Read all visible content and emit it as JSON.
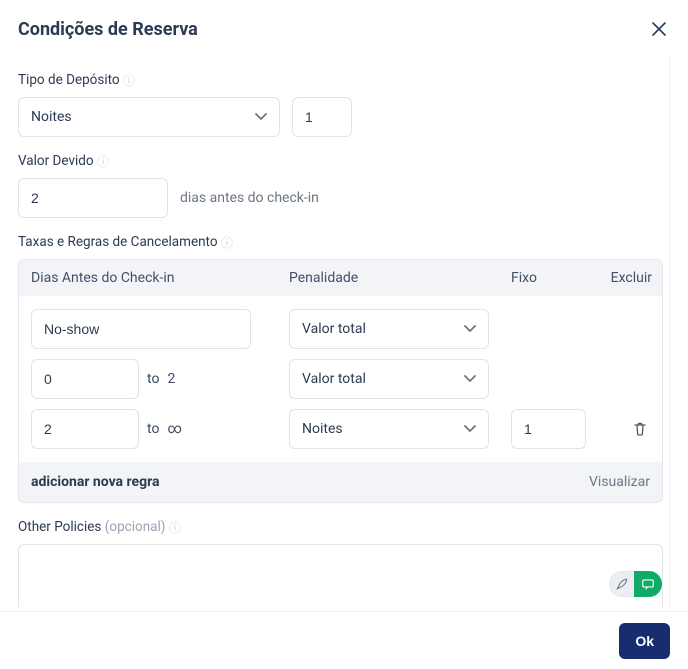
{
  "header": {
    "title": "Condições de Reserva"
  },
  "deposit": {
    "label": "Tipo de Depósito",
    "type_value": "Noites",
    "qty_value": "1"
  },
  "due": {
    "label": "Valor Devido",
    "days_value": "2",
    "hint": "dias antes do check-in"
  },
  "fees": {
    "label": "Taxas e Regras de Cancelamento",
    "headers": {
      "a": "Dias Antes do Check-in",
      "b": "Penalidade",
      "c": "Fixo",
      "d": "Excluir"
    },
    "to_word": "to",
    "rows": [
      {
        "from": "No-show",
        "to": "",
        "penalty": "Valor total",
        "fixed": "",
        "deletable": false
      },
      {
        "from": "0",
        "to": "2",
        "penalty": "Valor total",
        "fixed": "",
        "deletable": false
      },
      {
        "from": "2",
        "to": "∞",
        "penalty": "Noites",
        "fixed": "1",
        "deletable": true
      }
    ],
    "add_label": "adicionar nova regra",
    "view_label": "Visualizar"
  },
  "other": {
    "label": "Other Policies",
    "optional": "(opcional)"
  },
  "footer": {
    "ok": "Ok"
  }
}
